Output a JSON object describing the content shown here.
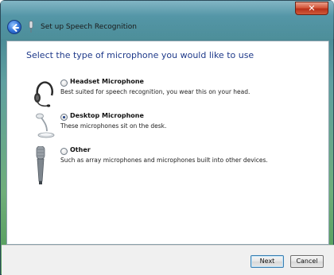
{
  "window": {
    "title": "Set up Speech Recognition",
    "close_label": "✕"
  },
  "main": {
    "heading": "Select the type of microphone you would like to use",
    "options": [
      {
        "label": "Headset Microphone",
        "description": "Best suited for speech recognition, you wear this on your head.",
        "selected": false,
        "icon": "headset-icon"
      },
      {
        "label": "Desktop Microphone",
        "description": "These microphones sit on the desk.",
        "selected": true,
        "icon": "desktop-microphone-icon"
      },
      {
        "label": "Other",
        "description": "Such as array microphones and microphones built into other devices.",
        "selected": false,
        "icon": "handheld-microphone-icon"
      }
    ]
  },
  "footer": {
    "next_label": "Next",
    "cancel_label": "Cancel"
  }
}
